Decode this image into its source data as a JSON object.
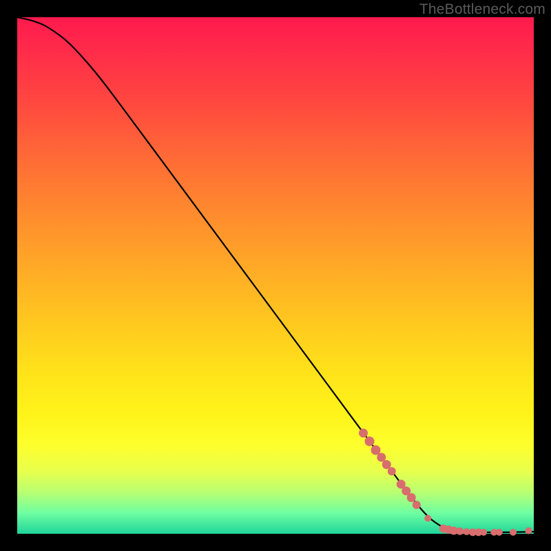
{
  "attribution": "TheBottleneck.com",
  "colors": {
    "dot": "#d86d6d",
    "curve": "#000000",
    "page_bg": "#000000"
  },
  "chart_data": {
    "type": "line",
    "title": "",
    "xlabel": "",
    "ylabel": "",
    "xlim": [
      0,
      100
    ],
    "ylim": [
      0,
      100
    ],
    "series": [
      {
        "name": "curve",
        "kind": "line",
        "points": [
          {
            "x": 0,
            "y": 100
          },
          {
            "x": 3,
            "y": 99.3
          },
          {
            "x": 6,
            "y": 98.0
          },
          {
            "x": 10,
            "y": 95.0
          },
          {
            "x": 15,
            "y": 89.5
          },
          {
            "x": 20,
            "y": 83.0
          },
          {
            "x": 30,
            "y": 69.5
          },
          {
            "x": 40,
            "y": 56.0
          },
          {
            "x": 50,
            "y": 42.5
          },
          {
            "x": 60,
            "y": 29.0
          },
          {
            "x": 70,
            "y": 15.5
          },
          {
            "x": 78,
            "y": 5.0
          },
          {
            "x": 82,
            "y": 1.5
          },
          {
            "x": 85,
            "y": 0.5
          },
          {
            "x": 90,
            "y": 0.3
          },
          {
            "x": 95,
            "y": 0.3
          },
          {
            "x": 100,
            "y": 0.4
          }
        ]
      },
      {
        "name": "highlighted-points",
        "kind": "scatter",
        "points": [
          {
            "x": 67.0,
            "y": 19.5,
            "r": 6.5
          },
          {
            "x": 68.2,
            "y": 17.9,
            "r": 7.0
          },
          {
            "x": 69.4,
            "y": 16.2,
            "r": 7.0
          },
          {
            "x": 70.5,
            "y": 14.8,
            "r": 6.5
          },
          {
            "x": 71.5,
            "y": 13.4,
            "r": 6.5
          },
          {
            "x": 72.5,
            "y": 12.1,
            "r": 6.0
          },
          {
            "x": 74.3,
            "y": 9.6,
            "r": 6.5
          },
          {
            "x": 75.3,
            "y": 8.3,
            "r": 6.5
          },
          {
            "x": 76.3,
            "y": 7.0,
            "r": 6.5
          },
          {
            "x": 77.3,
            "y": 5.6,
            "r": 6.0
          },
          {
            "x": 79.5,
            "y": 3.0,
            "r": 5.0
          },
          {
            "x": 82.5,
            "y": 1.0,
            "r": 6.0
          },
          {
            "x": 83.5,
            "y": 0.8,
            "r": 6.0
          },
          {
            "x": 84.5,
            "y": 0.6,
            "r": 6.0
          },
          {
            "x": 85.7,
            "y": 0.5,
            "r": 5.5
          },
          {
            "x": 87.0,
            "y": 0.4,
            "r": 5.0
          },
          {
            "x": 88.2,
            "y": 0.3,
            "r": 5.5
          },
          {
            "x": 89.3,
            "y": 0.3,
            "r": 5.5
          },
          {
            "x": 90.3,
            "y": 0.3,
            "r": 5.0
          },
          {
            "x": 92.3,
            "y": 0.3,
            "r": 5.0
          },
          {
            "x": 93.3,
            "y": 0.3,
            "r": 5.0
          },
          {
            "x": 96.0,
            "y": 0.3,
            "r": 5.0
          },
          {
            "x": 99.0,
            "y": 0.6,
            "r": 5.0
          }
        ]
      }
    ]
  }
}
